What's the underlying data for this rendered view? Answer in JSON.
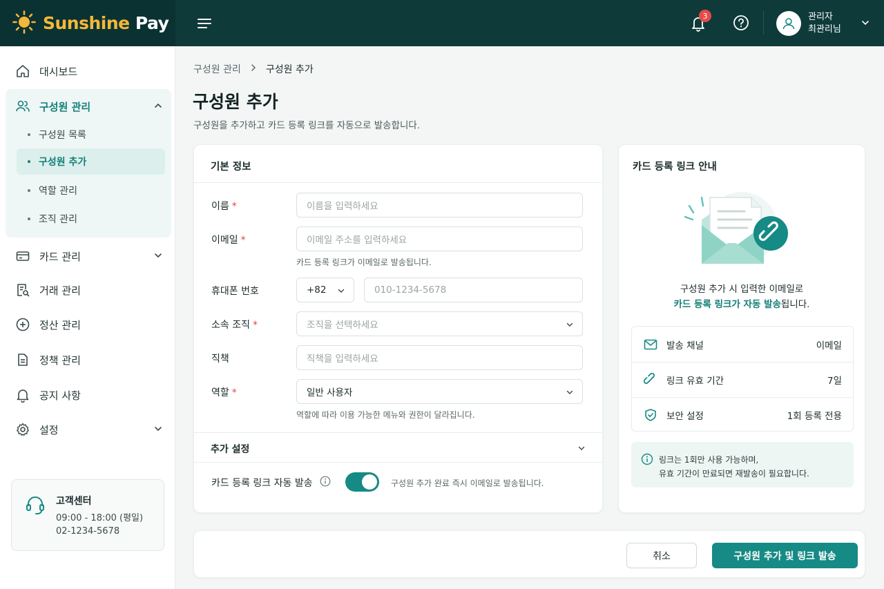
{
  "brand": {
    "name_part1": "Sunshine",
    "name_part2": "Pay"
  },
  "header": {
    "notification_count": "3",
    "user_role": "관리자",
    "user_name": "최관리님"
  },
  "sidebar": {
    "items": [
      {
        "label": "대시보드",
        "icon": "home-icon"
      },
      {
        "label": "구성원 관리",
        "icon": "users-icon"
      },
      {
        "label": "카드 관리",
        "icon": "card-icon"
      },
      {
        "label": "거래 관리",
        "icon": "receipt-search-icon"
      },
      {
        "label": "정산 관리",
        "icon": "coin-plus-icon"
      },
      {
        "label": "정책 관리",
        "icon": "document-icon"
      },
      {
        "label": "공지 사항",
        "icon": "bell-icon"
      },
      {
        "label": "설정",
        "icon": "gear-icon"
      }
    ],
    "sub_items": [
      {
        "label": "구성원 목록"
      },
      {
        "label": "구성원 추가"
      },
      {
        "label": "역할 관리"
      },
      {
        "label": "조직 관리"
      }
    ],
    "support": {
      "title": "고객센터",
      "hours": "09:00 - 18:00 (평일)",
      "phone": "02-1234-5678"
    }
  },
  "breadcrumb": {
    "parent": "구성원 관리",
    "current": "구성원 추가"
  },
  "page": {
    "title": "구성원 추가",
    "description": "구성원을 추가하고 카드 등록 링크를 자동으로 발송합니다."
  },
  "form": {
    "section_title": "기본 정보",
    "required_mark": "*",
    "name": {
      "label": "이름",
      "placeholder": "이름을 입력하세요"
    },
    "email": {
      "label": "이메일",
      "placeholder": "이메일 주소를 입력하세요",
      "help": "카드 등록 링크가 이메일로 발송됩니다."
    },
    "phone": {
      "label": "휴대폰 번호",
      "country_code": "+82",
      "placeholder": "010-1234-5678"
    },
    "org": {
      "label": "소속 조직",
      "placeholder": "조직을 선택하세요"
    },
    "position": {
      "label": "직책",
      "placeholder": "직책을 입력하세요"
    },
    "role": {
      "label": "역할",
      "value": "일반 사용자",
      "help": "역할에 따라 이용 가능한 메뉴와 권한이 달라집니다."
    },
    "extra_title": "추가 설정",
    "auto_send": {
      "label": "카드 등록 링크 자동 발송",
      "enabled": true,
      "description": "구성원 추가 완료 즉시 이메일로 발송됩니다."
    }
  },
  "info_panel": {
    "title": "카드 등록 링크 안내",
    "line1": "구성원 추가 시 입력한 이메일로",
    "line2_highlight": "카드 등록 링크가 자동 발송",
    "line2_rest": "됩니다.",
    "rows": [
      {
        "label": "발송 채널",
        "value": "이메일",
        "icon": "mail-icon"
      },
      {
        "label": "링크 유효 기간",
        "value": "7일",
        "icon": "link-icon"
      },
      {
        "label": "보안 설정",
        "value": "1회 등록 전용",
        "icon": "shield-check-icon"
      }
    ],
    "notice_line1": "링크는 1회만 사용 가능하며,",
    "notice_line2": "유효 기간이 만료되면 재발송이 필요합니다."
  },
  "actions": {
    "cancel": "취소",
    "submit": "구성원 추가 및 링크 발송"
  },
  "colors": {
    "header_bg": "#0f3a3a",
    "accent": "#168a84",
    "brand_yellow": "#f4b73a",
    "required": "#e04545"
  }
}
